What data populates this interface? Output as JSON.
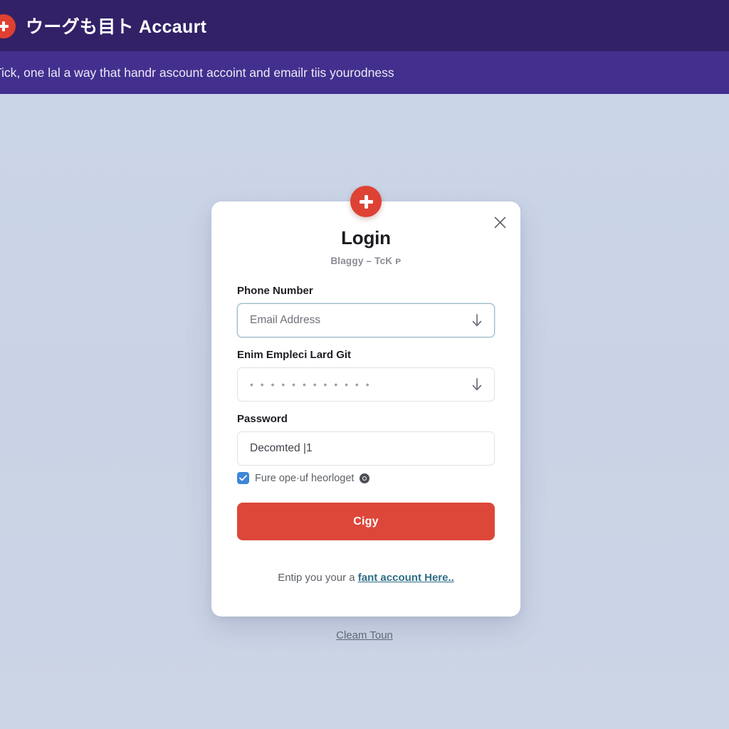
{
  "topbar": {
    "title": "ウーグも目ト Accaurt",
    "badge_icon": "plus-circle-icon"
  },
  "subbanner": {
    "text": "Tick, one lal a way that handr ascount accoint and emailr tiis yourodness"
  },
  "card": {
    "badge_icon": "plus-circle-icon",
    "close_icon": "close-icon",
    "title": "Login",
    "subtitle": "Blaɡɡy – TcK ᴘ",
    "fields": [
      {
        "label": "Phone Number",
        "placeholder": "Email Address",
        "value": "",
        "focused": true,
        "arrow_icon": "arrow-down-icon"
      },
      {
        "label": "Enim Empleci Lard Git",
        "placeholder": "",
        "value": "• • • • • • • • • • • •",
        "focused": false,
        "arrow_icon": "arrow-down-icon"
      },
      {
        "label": "Password",
        "placeholder": "",
        "value": "Decomted |1",
        "focused": false,
        "arrow_icon": ""
      }
    ],
    "checkbox": {
      "checked": true,
      "label": "Fure ope·uf heorloget",
      "info_icon": "info-circle-icon"
    },
    "submit_label": "Cigy",
    "footer": {
      "prefix": "Entip you your a ",
      "link": "fant account Here.."
    }
  },
  "below_link": {
    "label": "Cleam Toun"
  },
  "colors": {
    "header": "#322167",
    "subbanner": "#432f8e",
    "accent_red": "#dd473a",
    "page_bg": "#cbd5e8",
    "checkbox_blue": "#3d86d8",
    "link_blue": "#2f6e87"
  }
}
